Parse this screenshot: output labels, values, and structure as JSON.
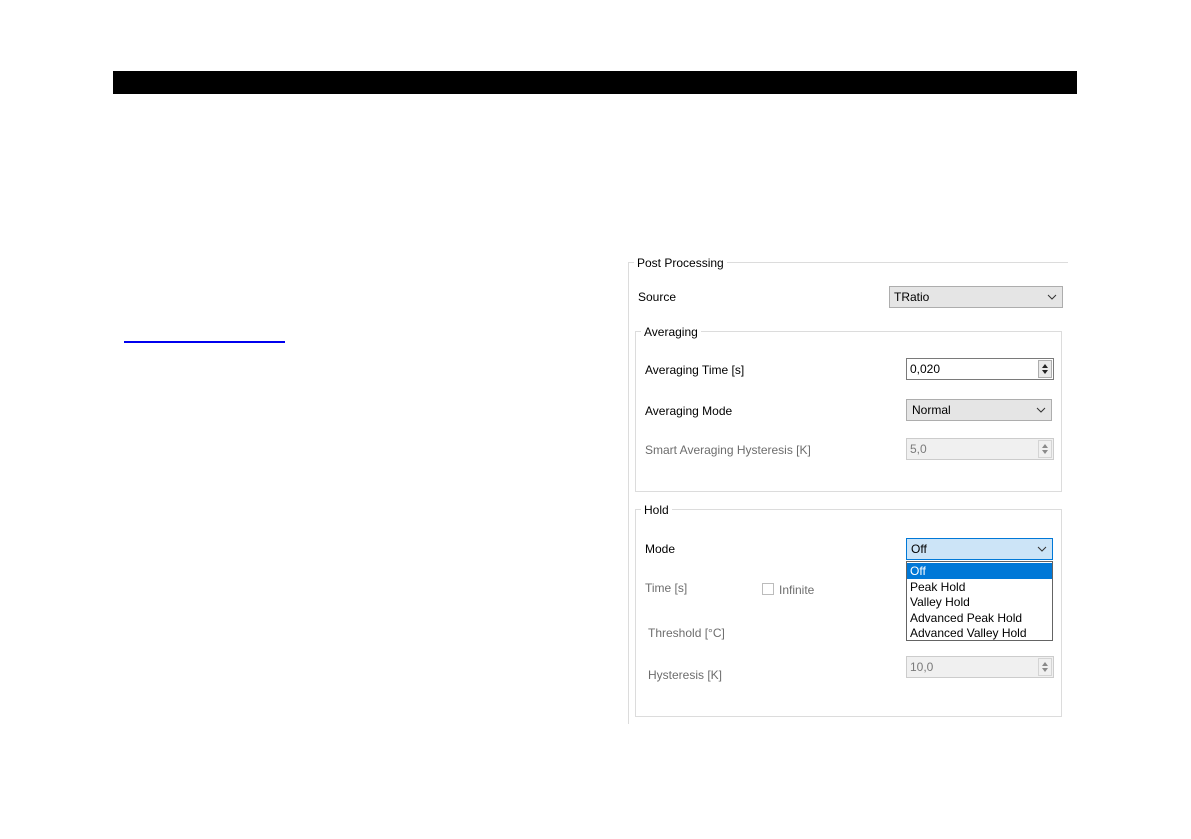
{
  "post_processing": {
    "title": "Post Processing",
    "source_label": "Source",
    "source_value": "TRatio"
  },
  "averaging": {
    "title": "Averaging",
    "time_label": "Averaging Time [s]",
    "time_value": "0,020",
    "mode_label": "Averaging Mode",
    "mode_value": "Normal",
    "hysteresis_label": "Smart Averaging Hysteresis [K]",
    "hysteresis_value": "5,0"
  },
  "hold": {
    "title": "Hold",
    "mode_label": "Mode",
    "mode_value": "Off",
    "time_label": "Time [s]",
    "infinite_label": "Infinite",
    "threshold_label": "Threshold [°C]",
    "hysteresis_label": "Hysteresis [K]",
    "hysteresis_value": "10,0",
    "mode_options": [
      "Off",
      "Peak Hold",
      "Valley Hold",
      "Advanced Peak Hold",
      "Advanced Valley Hold"
    ]
  },
  "colors": {
    "selection": "#0078d7",
    "combo_active": "#cce4f7",
    "link": "#0000ee"
  }
}
